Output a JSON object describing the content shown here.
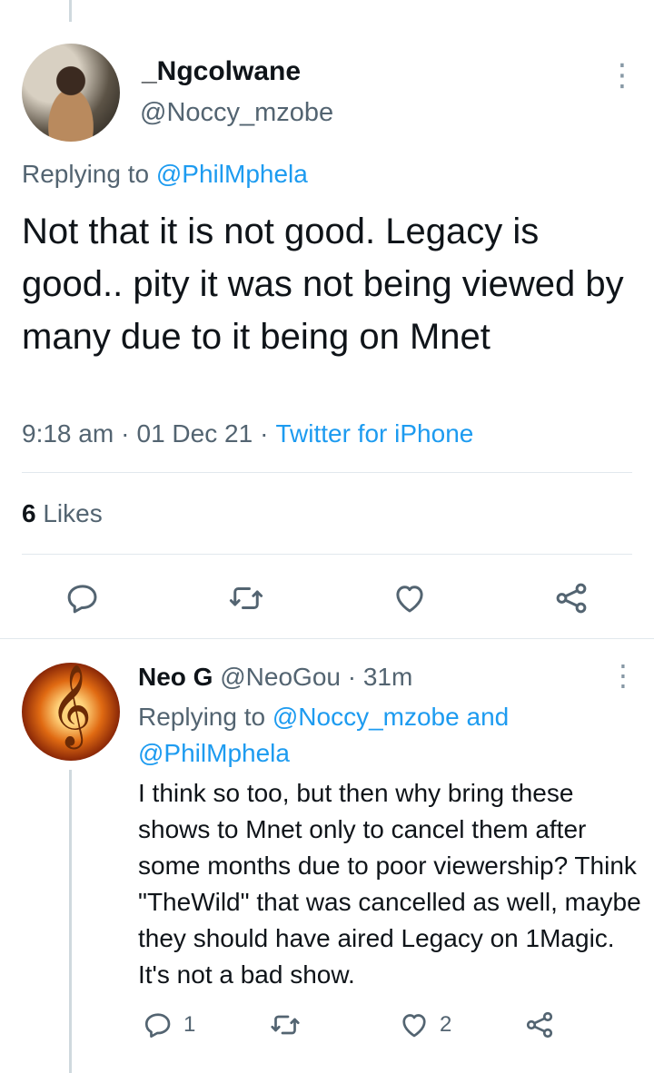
{
  "main_tweet": {
    "display_name": "_Ngcolwane",
    "handle": "@Noccy_mzobe",
    "replying_prefix": "Replying to ",
    "replying_to": "@PhilMphela",
    "text": "Not that it is not good. Legacy is good.. pity it was not being viewed by many due to it being on Mnet",
    "time": "9:18 am",
    "date": "01 Dec 21",
    "separator": "·",
    "source": "Twitter for iPhone",
    "likes_count": "6",
    "likes_label": " Likes"
  },
  "reply_tweet": {
    "display_name": "Neo G",
    "handle": "@NeoGou",
    "separator": " · ",
    "age": "31m",
    "replying_prefix": "Replying to ",
    "replying_to_1": "@Noccy_mzobe",
    "replying_and": " and",
    "replying_to_2": "@PhilMphela",
    "text": "I think so too, but then why bring these shows to Mnet only to cancel them after some months due to poor viewership? Think \"TheWild\" that was cancelled as well, maybe they should have aired Legacy on 1Magic. It's not a bad show.",
    "reply_count": "1",
    "like_count": "2"
  },
  "icons": {
    "more": "more-vertical-icon",
    "reply": "reply-icon",
    "retweet": "retweet-icon",
    "like": "heart-icon",
    "share": "share-icon",
    "avatar_reply_glyph": "𝄞"
  },
  "colors": {
    "accent": "#1d9bf0",
    "secondary_text": "#536471"
  }
}
